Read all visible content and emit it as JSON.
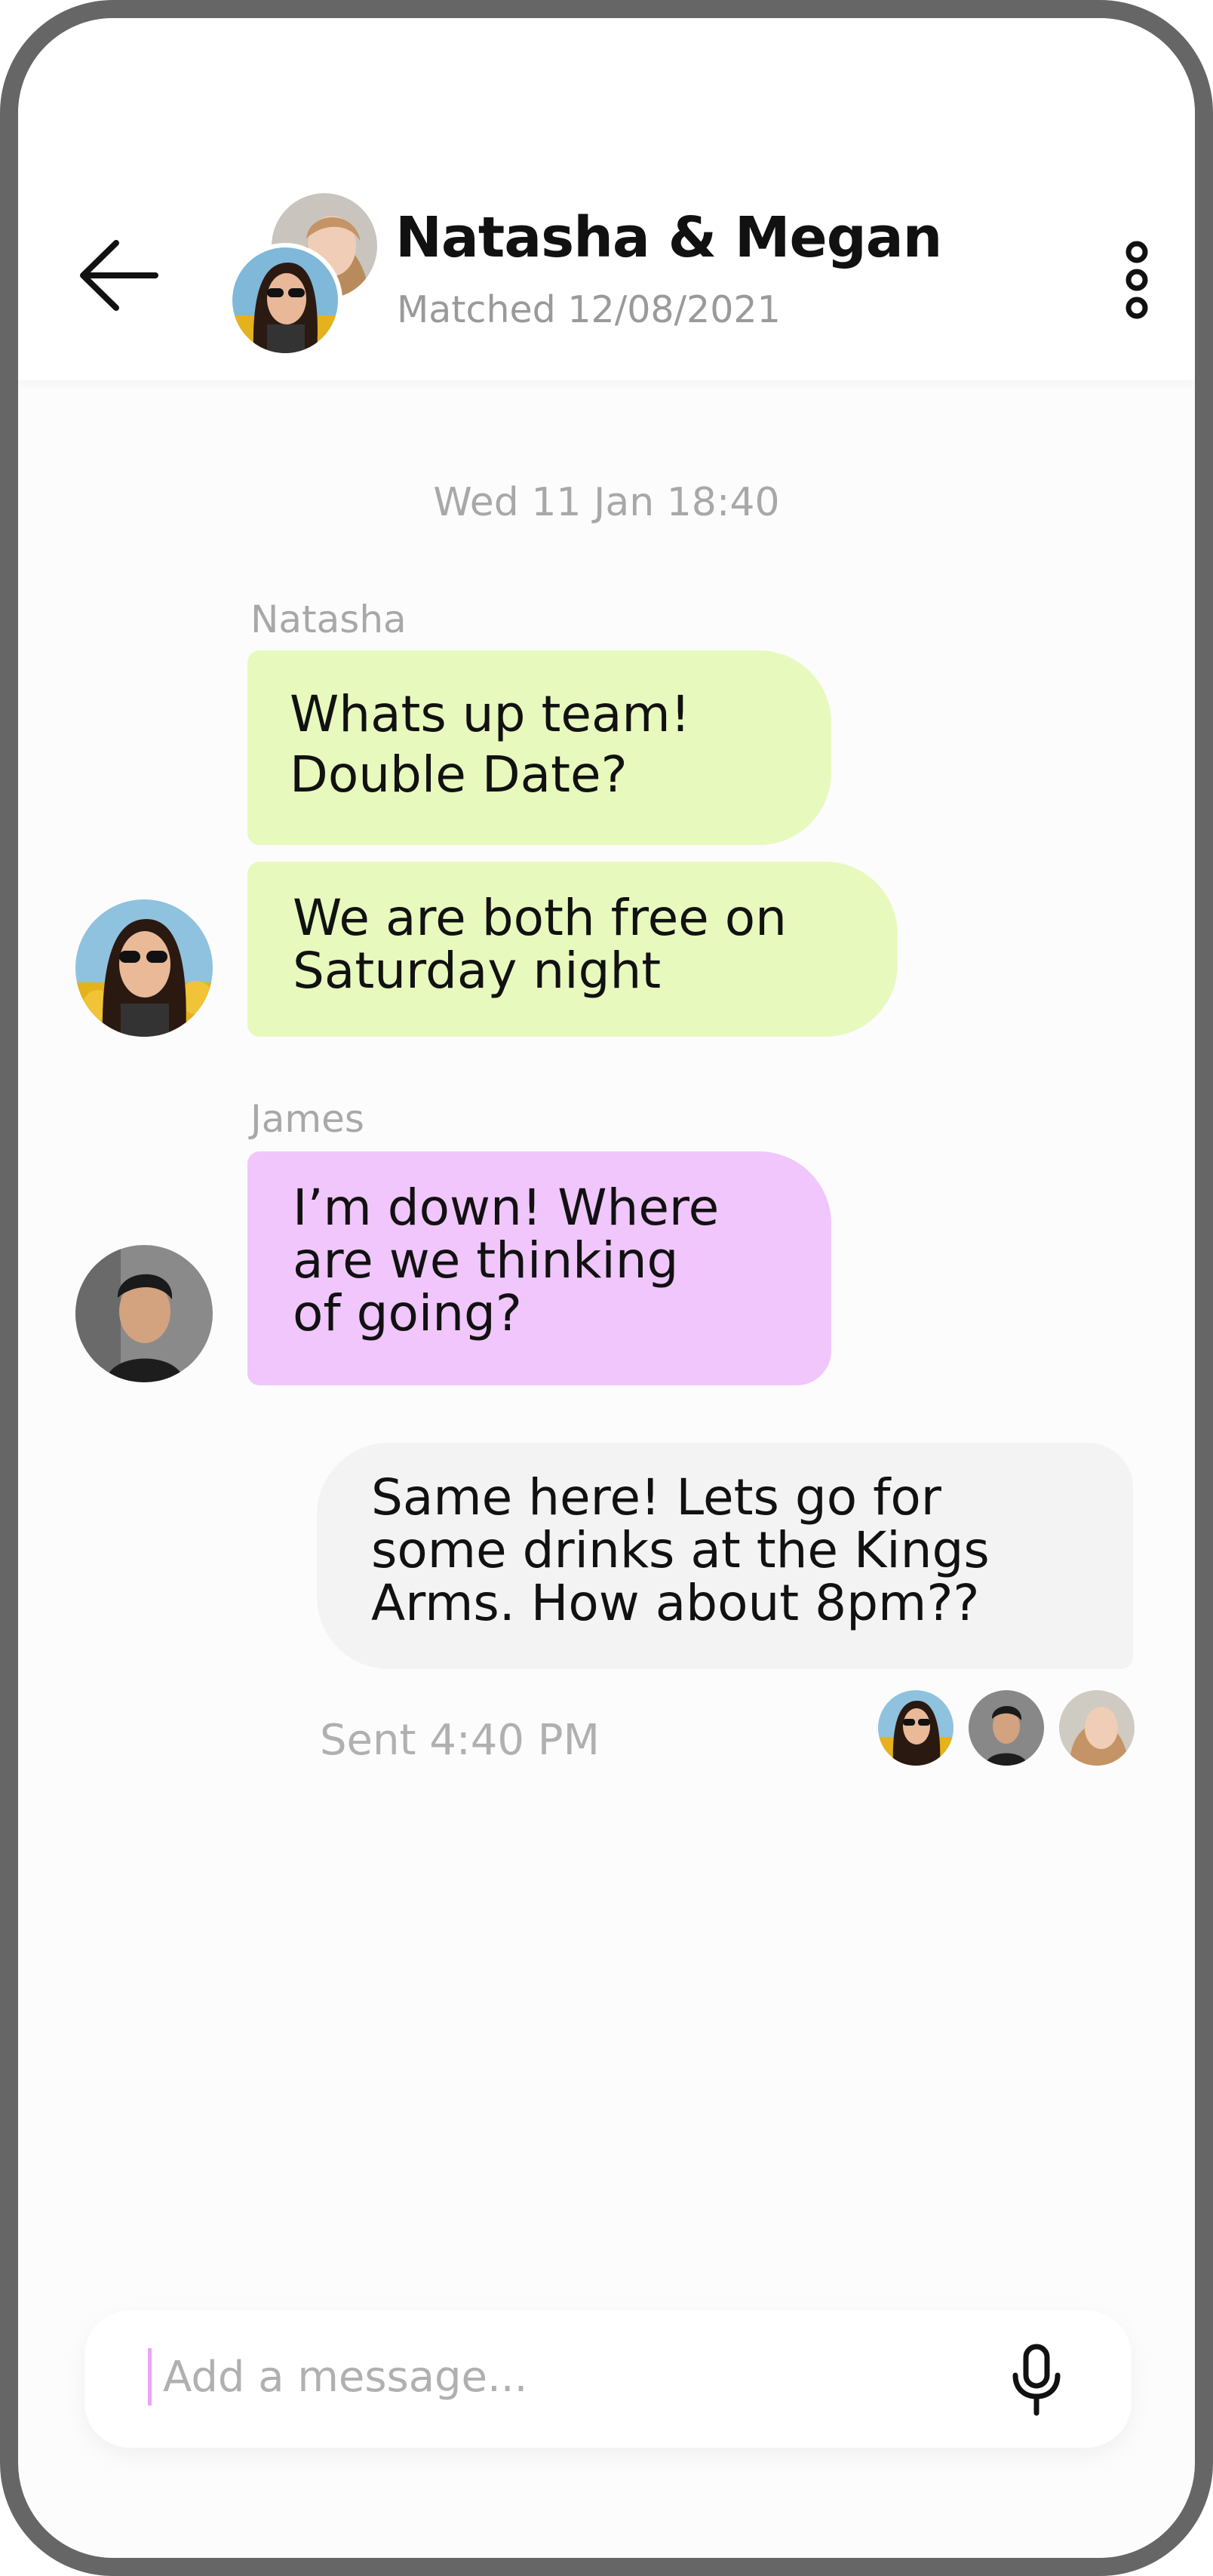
{
  "header": {
    "title": "Natasha & Megan",
    "subtitle": "Matched 12/08/2021",
    "back_icon": "arrow-left-icon",
    "more_icon": "more-vertical-icon"
  },
  "chat": {
    "date_separator": "Wed 11 Jan 18:40",
    "groups": [
      {
        "sender": "Natasha",
        "messages": [
          [
            "Whats up team!",
            "Double Date?"
          ],
          [
            "We are both free on",
            "Saturday night"
          ]
        ],
        "color": "#e8f9be"
      },
      {
        "sender": "James",
        "messages": [
          [
            "I’m down! Where",
            "are we thinking",
            "of going?"
          ]
        ],
        "color": "#f0c6fc"
      }
    ],
    "outgoing": {
      "lines": [
        "Same here! Lets go for",
        "some drinks at the Kings",
        "Arms. How about 8pm??"
      ],
      "status": "Sent 4:40 PM",
      "color": "#f3f3f3"
    }
  },
  "composer": {
    "placeholder": "Add a message...",
    "mic_icon": "microphone-icon"
  },
  "colors": {
    "frame": "#666666",
    "background": "#fcfcfd",
    "accent_caret": "#e8a6f7"
  }
}
